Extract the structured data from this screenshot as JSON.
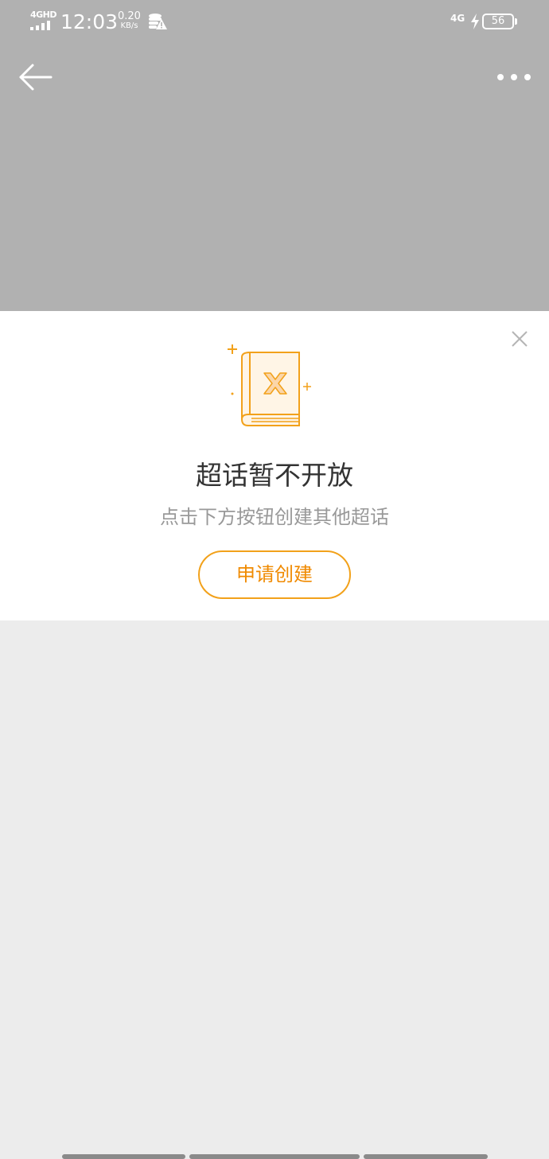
{
  "status_bar": {
    "network_label": "4GHD",
    "time": "12:03",
    "speed_value": "0.20",
    "speed_unit": "KB/s",
    "network_right": "4G",
    "battery": "56"
  },
  "header": {
    "back_icon": "arrow-left-icon",
    "more_icon": "more-dots-icon"
  },
  "card": {
    "close_icon": "close-icon",
    "illustration_icon": "book-error-icon",
    "title": "超话暂不开放",
    "subtitle": "点击下方按钮创建其他超话",
    "button_label": "申请创建"
  },
  "colors": {
    "header_bg": "#b1b1b1",
    "page_bg": "#ececec",
    "accent": "#f2a11a",
    "accent_text": "#f08a00",
    "title_text": "#333333",
    "subtitle_text": "#999999"
  }
}
